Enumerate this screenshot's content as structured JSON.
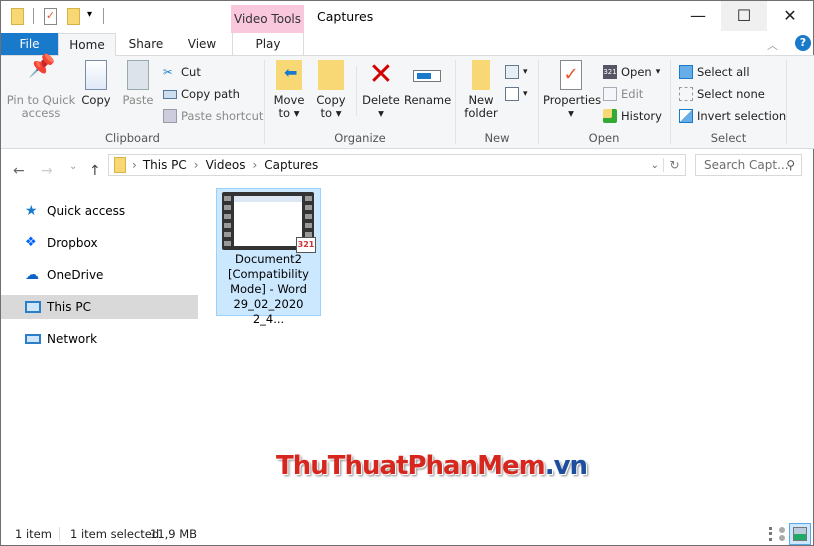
{
  "window": {
    "title": "Captures",
    "context_tab_group": "Video Tools"
  },
  "tabs": {
    "file": "File",
    "home": "Home",
    "share": "Share",
    "view": "View",
    "play": "Play"
  },
  "ribbon": {
    "clipboard": {
      "label": "Clipboard",
      "pin": "Pin to Quick access",
      "pin_l1": "Pin to Quick",
      "pin_l2": "access",
      "copy": "Copy",
      "paste": "Paste",
      "cut": "Cut",
      "copy_path": "Copy path",
      "paste_shortcut": "Paste shortcut"
    },
    "organize": {
      "label": "Organize",
      "move_l1": "Move",
      "move_l2": "to",
      "copy_l1": "Copy",
      "copy_l2": "to",
      "delete": "Delete",
      "rename": "Rename"
    },
    "new": {
      "label": "New",
      "new_l1": "New",
      "new_l2": "folder"
    },
    "open": {
      "label": "Open",
      "properties": "Properties",
      "open": "Open",
      "edit": "Edit",
      "history": "History"
    },
    "select": {
      "label": "Select",
      "select_all": "Select all",
      "select_none": "Select none",
      "invert": "Invert selection"
    }
  },
  "address": {
    "crumbs": [
      "This PC",
      "Videos",
      "Captures"
    ],
    "search_placeholder": "Search Capt..."
  },
  "sidebar": {
    "items": [
      {
        "label": "Quick access"
      },
      {
        "label": "Dropbox"
      },
      {
        "label": "OneDrive"
      },
      {
        "label": "This PC"
      },
      {
        "label": "Network"
      }
    ]
  },
  "files": [
    {
      "name_lines": [
        "Document2",
        "[Compatibility",
        "Mode] - Word",
        "29_02_2020 2_4..."
      ]
    }
  ],
  "status": {
    "count": "1 item",
    "selected": "1 item selected",
    "size": "11,9 MB"
  },
  "watermark": "ThuThuatPhanMem.vn",
  "colors": {
    "accent": "#1979ca",
    "selection": "#cce8ff",
    "context": "#f9c8dd"
  }
}
